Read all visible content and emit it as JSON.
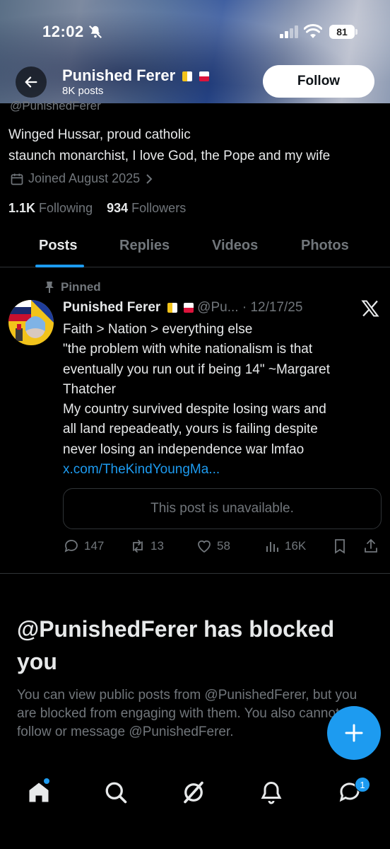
{
  "status_bar": {
    "time": "12:02",
    "battery": "81"
  },
  "header": {
    "name": "Punished Ferer",
    "posts_count": "8K posts",
    "follow_label": "Follow"
  },
  "profile": {
    "handle_partial": "@PunishedFerer",
    "bio_line1": "Winged Hussar, proud catholic",
    "bio_line2": "staunch monarchist, I love God, the Pope and my wife",
    "joined": "Joined August 2025",
    "following_count": "1.1K",
    "following_label": "Following",
    "followers_count": "934",
    "followers_label": "Followers"
  },
  "tabs": [
    "Posts",
    "Replies",
    "Videos",
    "Photos"
  ],
  "post": {
    "pinned_label": "Pinned",
    "author": "Punished Ferer",
    "handle": "@Pu...",
    "separator": "·",
    "date": "12/17/25",
    "lines": [
      "Faith > Nation > everything else",
      "\"the problem with white nationalism is that",
      "eventually you run out if being 14\" ~Margaret",
      "Thatcher",
      "My country survived despite losing wars and",
      "all land repeadeatly, yours is failing despite",
      "never losing an independence war lmfao"
    ],
    "link": "x.com/TheKindYoungMa...",
    "quote_unavailable": "This post is unavailable.",
    "replies": "147",
    "reposts": "13",
    "likes": "58",
    "views": "16K"
  },
  "blocked": {
    "title": "@PunishedFerer has blocked you",
    "description": "You can view public posts from @PunishedFerer, but you are blocked from engaging with them. You also cannot follow or message @PunishedFerer."
  },
  "nav": {
    "messages_badge": "1"
  },
  "colors": {
    "accent": "#1d9bf0",
    "muted": "#71767b",
    "text": "#e7e9ea"
  }
}
